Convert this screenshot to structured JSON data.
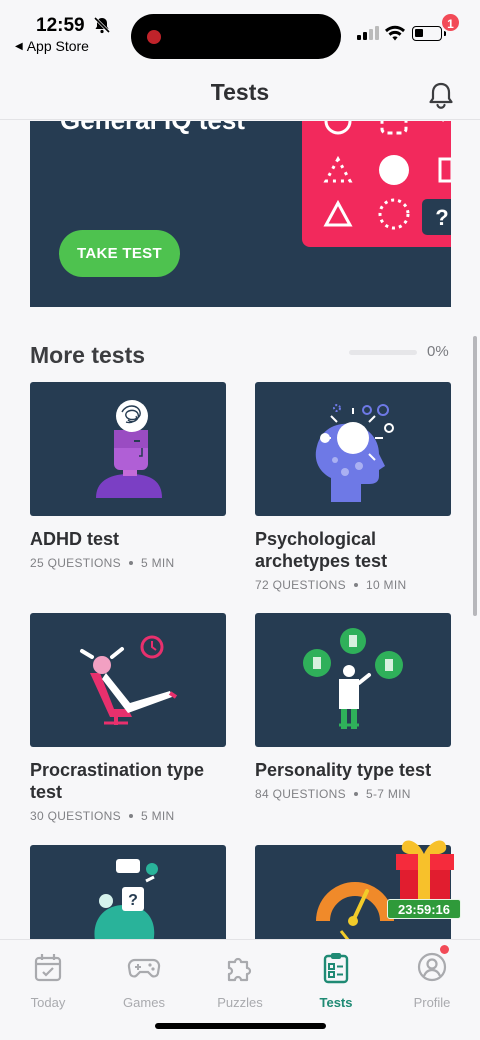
{
  "status_bar": {
    "time": "12:59",
    "back_label": "App Store"
  },
  "header": {
    "title": "Tests",
    "notification_count": "1"
  },
  "hero": {
    "title": "General IQ test",
    "button_label": "TAKE TEST"
  },
  "more_tests": {
    "title": "More tests",
    "progress_text": "0%",
    "progress_value": 0
  },
  "cards": [
    {
      "title": "ADHD test",
      "questions": "25 QUESTIONS",
      "duration": "5 MIN"
    },
    {
      "title": "Psychological archetypes test",
      "questions": "72 QUESTIONS",
      "duration": "10 MIN"
    },
    {
      "title": "Procrastination type test",
      "questions": "30 QUESTIONS",
      "duration": "5 MIN"
    },
    {
      "title": "Personality type test",
      "questions": "84 QUESTIONS",
      "duration": "5-7 MIN"
    }
  ],
  "gift": {
    "timer": "23:59:16"
  },
  "tabs": [
    {
      "label": "Today",
      "icon": "calendar-icon"
    },
    {
      "label": "Games",
      "icon": "gamepad-icon"
    },
    {
      "label": "Puzzles",
      "icon": "puzzle-icon"
    },
    {
      "label": "Tests",
      "icon": "clipboard-icon",
      "active": true
    },
    {
      "label": "Profile",
      "icon": "user-icon"
    }
  ],
  "colors": {
    "card_bg": "#263c52",
    "accent_green": "#4ec24f",
    "tab_active": "#1f8a74",
    "badge_red": "#f24a57",
    "hero_pink": "#f2295c"
  }
}
